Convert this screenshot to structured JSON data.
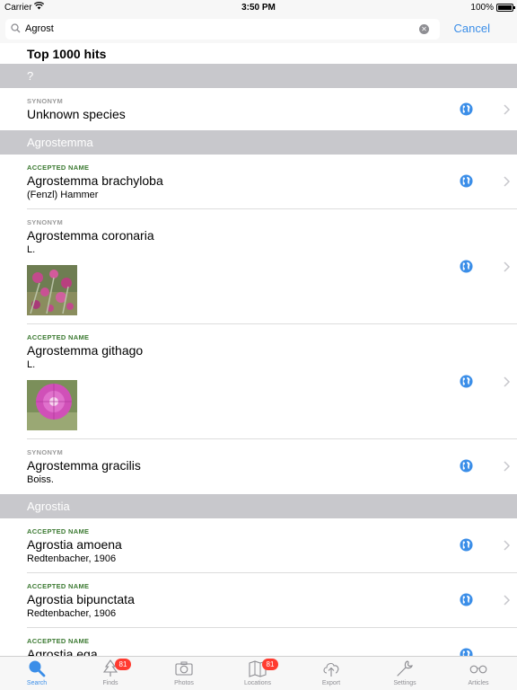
{
  "status_bar": {
    "carrier": "Carrier",
    "time": "3:50 PM",
    "battery": "100%"
  },
  "search": {
    "value": "Agrost",
    "cancel": "Cancel"
  },
  "results_title": "Top 1000 hits",
  "sections": [
    {
      "header": "?",
      "rows": [
        {
          "kind": "SYNONYM",
          "name": "Unknown species",
          "author": ""
        }
      ]
    },
    {
      "header": "Agrostemma",
      "rows": [
        {
          "kind": "ACCEPTED NAME",
          "name": "Agrostemma brachyloba",
          "author": "(Fenzl) Hammer"
        },
        {
          "kind": "SYNONYM",
          "name": "Agrostemma coronaria",
          "author": "L."
        },
        {
          "kind": "ACCEPTED NAME",
          "name": "Agrostemma githago",
          "author": "L."
        },
        {
          "kind": "SYNONYM",
          "name": "Agrostemma gracilis",
          "author": "Boiss."
        }
      ]
    },
    {
      "header": "Agrostia",
      "rows": [
        {
          "kind": "ACCEPTED NAME",
          "name": "Agrostia amoena",
          "author": "Redtenbacher, 1906"
        },
        {
          "kind": "ACCEPTED NAME",
          "name": "Agrostia bipunctata",
          "author": "Redtenbacher, 1906"
        },
        {
          "kind": "ACCEPTED NAME",
          "name": "Agrostia ega",
          "author": ""
        }
      ]
    }
  ],
  "tabs": [
    {
      "label": "Search",
      "icon": "search-icon",
      "badge": ""
    },
    {
      "label": "Finds",
      "icon": "tree-icon",
      "badge": "81"
    },
    {
      "label": "Photos",
      "icon": "camera-icon",
      "badge": ""
    },
    {
      "label": "Locations",
      "icon": "map-icon",
      "badge": "81"
    },
    {
      "label": "Export",
      "icon": "cloud-upload-icon",
      "badge": ""
    },
    {
      "label": "Settings",
      "icon": "wrench-icon",
      "badge": ""
    },
    {
      "label": "Articles",
      "icon": "glasses-icon",
      "badge": ""
    }
  ],
  "colors": {
    "accent": "#3b8ee8",
    "accepted": "#3c7a32",
    "synonym": "#9b9b9b",
    "section_bg": "#c8c8cc",
    "badge": "#ff3b30"
  }
}
